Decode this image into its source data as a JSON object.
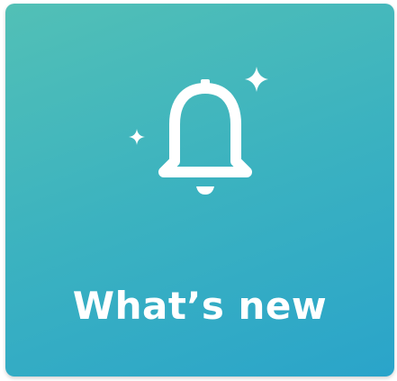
{
  "tile": {
    "label": "What’s new",
    "icon": "bell-icon",
    "decorations": [
      "sparkle-icon",
      "sparkle-icon"
    ],
    "colors": {
      "gradient_start": "#52c0b6",
      "gradient_end": "#2aa4ca",
      "foreground": "#ffffff"
    }
  }
}
